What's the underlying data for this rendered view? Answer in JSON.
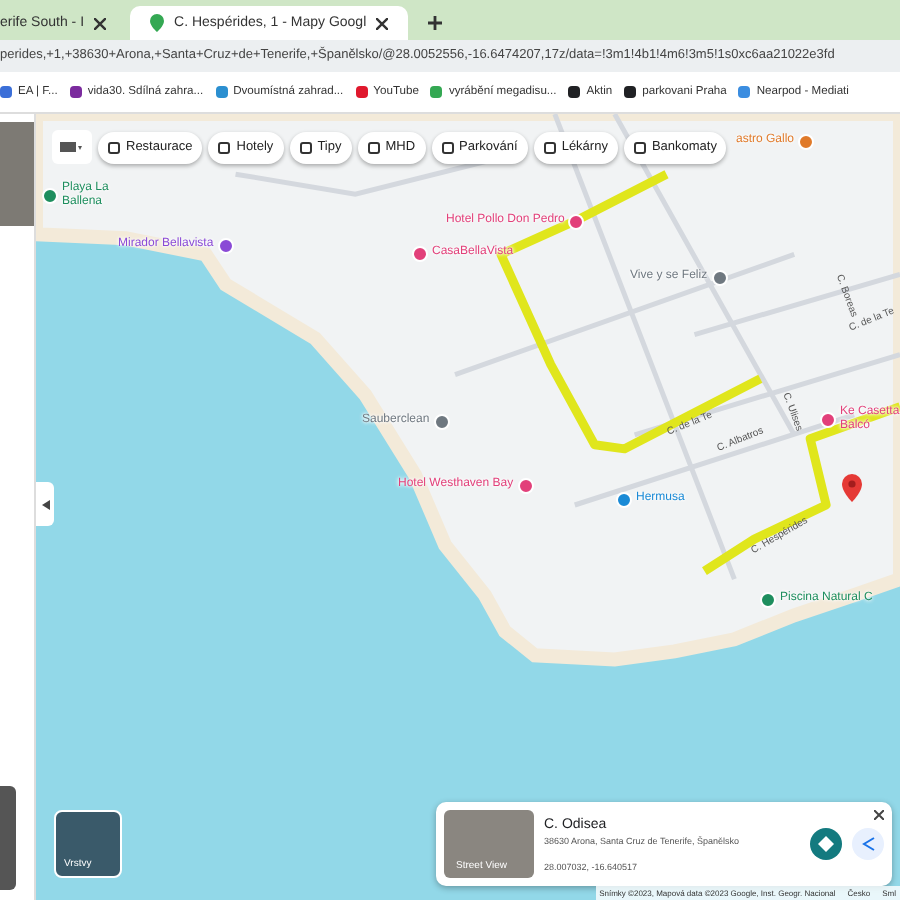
{
  "tabs": [
    {
      "title": "erife South - I",
      "selected": false
    },
    {
      "title": "C. Hespérides, 1 - Mapy Googl",
      "selected": true
    }
  ],
  "address_bar": {
    "url": "perides,+1,+38630+Arona,+Santa+Cruz+de+Tenerife,+Španělsko/@28.0052556,-16.6474207,17z/data=!3m1!4b1!4m6!3m5!1s0xc6aa21022e3fd"
  },
  "bookmarks": [
    {
      "label": "EA | F...",
      "color": "#3b6fd8"
    },
    {
      "label": "vida30. Sdílná zahra...",
      "color": "#7b2b9e"
    },
    {
      "label": "Dvoumístná zahrad...",
      "color": "#2b8fd0"
    },
    {
      "label": "YouTube",
      "color": "#e0182d"
    },
    {
      "label": "vyrábění megadisu...",
      "color": "#34a853"
    },
    {
      "label": "Aktin",
      "color": "#202124"
    },
    {
      "label": "parkovani Praha",
      "color": "#202124"
    },
    {
      "label": "Nearpod - Mediati",
      "color": "#3b8de0"
    }
  ],
  "category_chips": [
    "Restaurace",
    "Hotely",
    "Tipy",
    "MHD",
    "Parkování",
    "Lékárny",
    "Bankomaty"
  ],
  "map_places": [
    {
      "name": "Playa La Ballena",
      "color": "#1e8e5e"
    },
    {
      "name": "Mirador Bellavista",
      "color": "#8a4ad6"
    },
    {
      "name": "Hotel Pollo Don Pedro",
      "color": "#e2407a"
    },
    {
      "name": "CasaBellaVista",
      "color": "#e2407a"
    },
    {
      "name": "Vive y se Feliz",
      "color": "#6f7880"
    },
    {
      "name": "Sauberclean",
      "color": "#6f7880"
    },
    {
      "name": "Hotel Westhaven Bay",
      "color": "#e2407a"
    },
    {
      "name": "Hermusa",
      "color": "#1a8ad6"
    },
    {
      "name": "Ke Casetta Balcó",
      "color": "#e2407a"
    },
    {
      "name": "Piscina Natural C",
      "color": "#1e8e5e"
    },
    {
      "name": "astro Gallo",
      "color": "#e07a2a"
    }
  ],
  "streets": [
    "C. de la Te",
    "C. Albatros",
    "C. Ulises",
    "C. Hespérides",
    "C. Boreas",
    "C. de la Te"
  ],
  "place_card": {
    "title": "C. Odisea",
    "address": "38630 Arona, Santa Cruz de Tenerife, Španělsko",
    "coordinates": "28.007032, -16.640517",
    "street_view": "Street View"
  },
  "layers_button": "Vrstvy",
  "footer": [
    "Snímky ©2023, Mapová data ©2023 Google, Inst. Geogr. Nacional",
    "Česko",
    "Sml"
  ]
}
